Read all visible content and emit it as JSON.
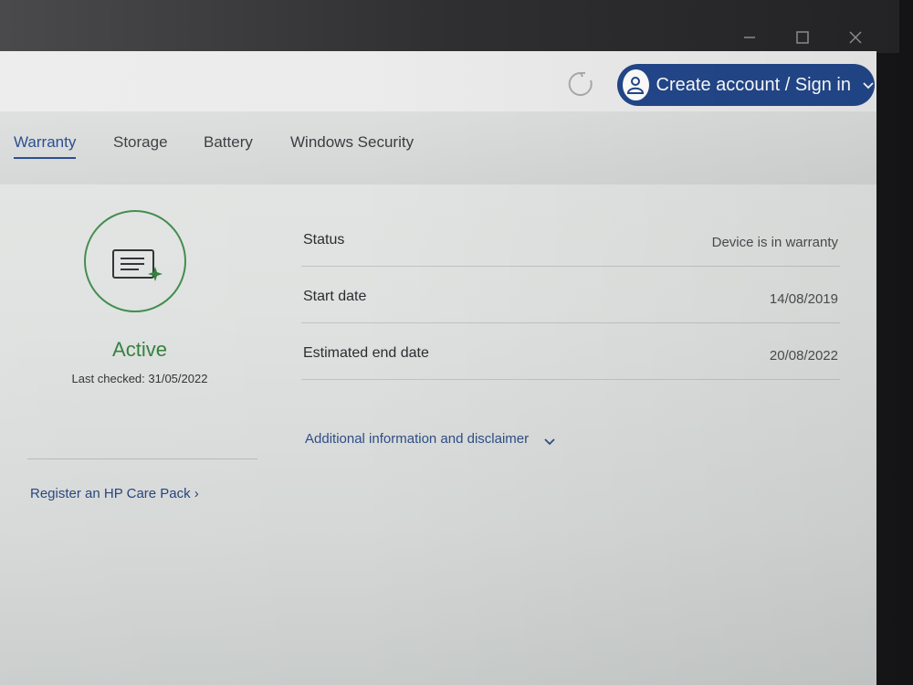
{
  "header": {
    "account_label": "Create account / Sign in",
    "accent_color": "#22478a"
  },
  "tabs": [
    {
      "label": "Warranty",
      "active": true
    },
    {
      "label": "Storage",
      "active": false
    },
    {
      "label": "Battery",
      "active": false
    },
    {
      "label": "Windows Security",
      "active": false
    }
  ],
  "warranty": {
    "state": "Active",
    "state_color": "#2f7d3a",
    "last_checked": "Last checked: 31/05/2022",
    "care_pack_link": "Register an HP Care Pack ›",
    "details": [
      {
        "label": "Status",
        "value": "Device is in warranty"
      },
      {
        "label": "Start date",
        "value": "14/08/2019"
      },
      {
        "label": "Estimated end date",
        "value": "20/08/2022"
      }
    ],
    "disclaimer_link": "Additional information and disclaimer"
  },
  "icons": {
    "refresh": "refresh-icon",
    "avatar": "user-icon",
    "warranty": "warranty-document-icon",
    "chevron": "chevron-down-icon",
    "minimize": "minimize-icon",
    "maximize": "maximize-icon",
    "close": "close-icon"
  }
}
